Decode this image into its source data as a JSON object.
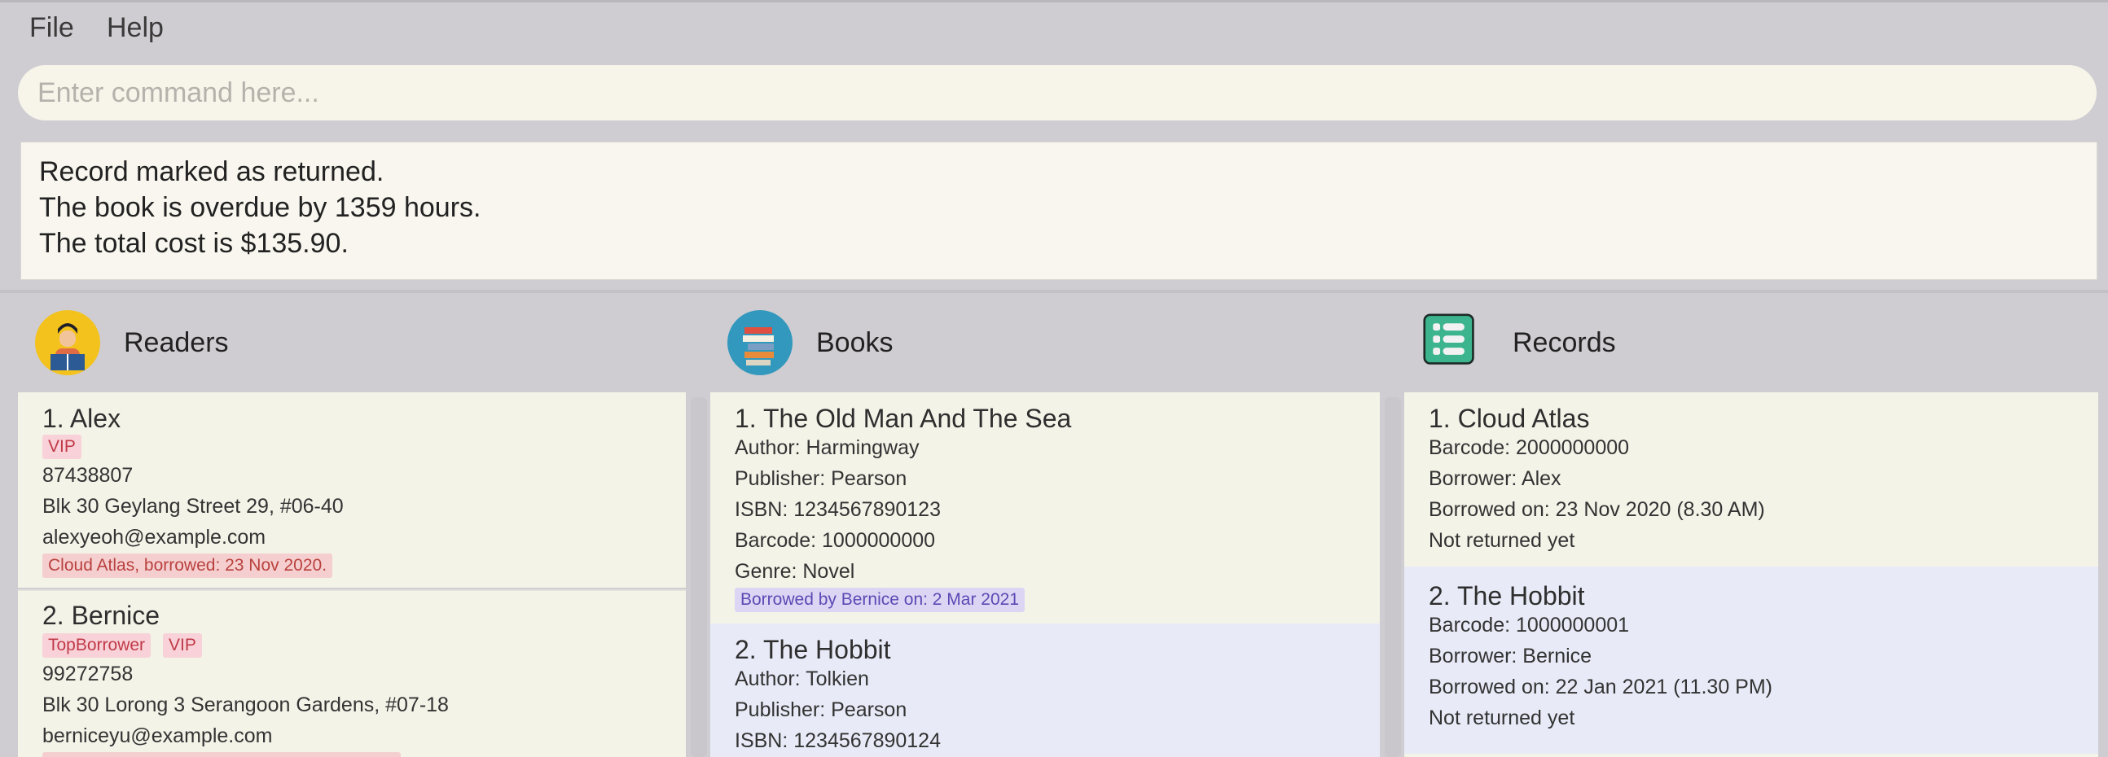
{
  "menu": {
    "file": "File",
    "help": "Help"
  },
  "command": {
    "placeholder": "Enter command here..."
  },
  "result": {
    "line1": "Record marked as returned.",
    "line2": "The book is overdue by 1359 hours.",
    "line3": "The total cost is $135.90."
  },
  "readers": {
    "title": "Readers",
    "items": [
      {
        "name": "1.  Alex",
        "tags": [
          "VIP"
        ],
        "phone": "87438807",
        "address": "Blk 30 Geylang Street 29, #06-40",
        "email": "alexyeoh@example.com",
        "borrow": "Cloud Atlas, borrowed: 23 Nov 2020."
      },
      {
        "name": "2.  Bernice",
        "tags": [
          "TopBorrower",
          "VIP"
        ],
        "phone": "99272758",
        "address": "Blk 30 Lorong 3 Serangoon Gardens, #07-18",
        "email": "berniceyu@example.com"
      }
    ]
  },
  "books": {
    "title": "Books",
    "items": [
      {
        "name": "1.  The Old Man And The Sea",
        "author": "Author: Harmingway",
        "publisher": "Publisher: Pearson",
        "isbn": "ISBN: 1234567890123",
        "barcode": "Barcode: 1000000000",
        "genre": "Genre: Novel",
        "status": "Borrowed by Bernice on: 2 Mar 2021"
      },
      {
        "name": "2.  The Hobbit",
        "author": "Author: Tolkien",
        "publisher": "Publisher: Pearson",
        "isbn": "ISBN: 1234567890124"
      }
    ]
  },
  "records": {
    "title": "Records",
    "items": [
      {
        "name": "1.  Cloud Atlas",
        "barcode": "Barcode: 2000000000",
        "borrower": "Borrower: Alex",
        "borrowed": "Borrowed on: 23 Nov 2020 (8.30 AM)",
        "returned": "Not returned yet"
      },
      {
        "name": "2.  The Hobbit",
        "barcode": "Barcode: 1000000001",
        "borrower": "Borrower: Bernice",
        "borrowed": "Borrowed on: 22 Jan 2021 (11.30 PM)",
        "returned": "Not returned yet"
      }
    ]
  },
  "icons": {
    "readers": "reader-avatar-icon",
    "books": "books-icon",
    "records": "list-icon"
  },
  "colors": {
    "background": "#cfcdd2",
    "card_odd": "#f4f3e8",
    "card_even": "#e8ebf7",
    "tag_pink": "#f8d2d8",
    "tag_purple": "#dcd6f4"
  }
}
